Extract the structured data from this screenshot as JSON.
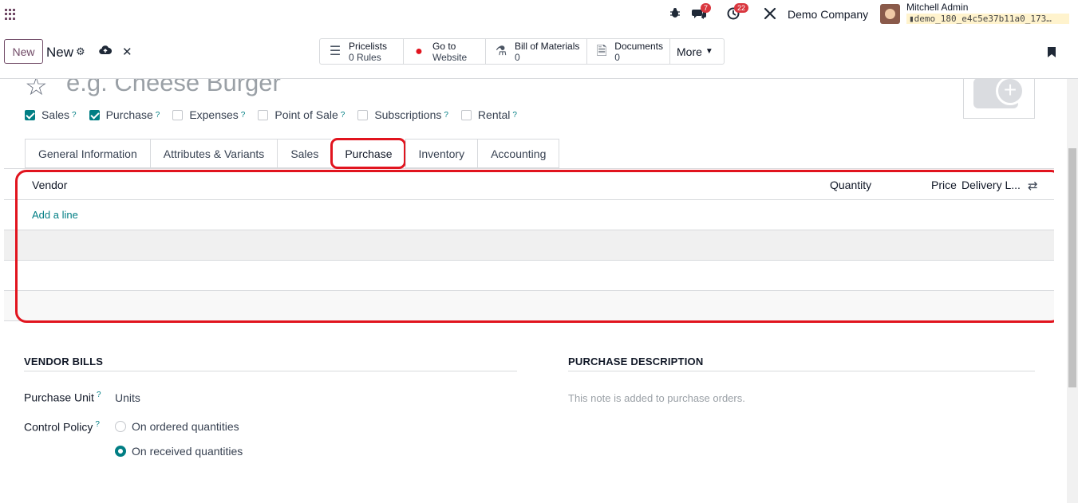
{
  "navbar": {
    "bug_badge": "",
    "messages_badge": "7",
    "activities_badge": "22",
    "company": "Demo Company",
    "user_name": "Mitchell Admin",
    "db_name": "demo_180_e4c5e37b11a0_173…"
  },
  "control": {
    "new_label": "New",
    "breadcrumb": "New",
    "smart_buttons": [
      {
        "title": "Pricelists",
        "sub": "0 Rules",
        "icon": "list-icon"
      },
      {
        "title": "Go to",
        "sub": "Website",
        "icon": "globe-icon"
      },
      {
        "title": "Bill of Materials",
        "sub": "0",
        "icon": "flask-icon"
      },
      {
        "title": "Documents",
        "sub": "0",
        "icon": "document-icon"
      }
    ],
    "more_label": "More"
  },
  "form": {
    "name_placeholder": "e.g. Cheese Burger",
    "checkboxes": [
      {
        "label": "Sales",
        "checked": true
      },
      {
        "label": "Purchase",
        "checked": true
      },
      {
        "label": "Expenses",
        "checked": false
      },
      {
        "label": "Point of Sale",
        "checked": false
      },
      {
        "label": "Subscriptions",
        "checked": false
      },
      {
        "label": "Rental",
        "checked": false
      }
    ],
    "tabs": [
      "General Information",
      "Attributes & Variants",
      "Sales",
      "Purchase",
      "Inventory",
      "Accounting"
    ],
    "active_tab": "Purchase",
    "vendor_list": {
      "columns": [
        "Vendor",
        "Quantity",
        "Price",
        "Delivery L..."
      ],
      "add_line": "Add a line"
    },
    "vendor_bills": {
      "title": "VENDOR BILLS",
      "purchase_unit_label": "Purchase Unit",
      "purchase_unit_value": "Units",
      "control_policy_label": "Control Policy",
      "options": [
        "On ordered quantities",
        "On received quantities"
      ],
      "selected": "On received quantities"
    },
    "purchase_description": {
      "title": "PURCHASE DESCRIPTION",
      "placeholder": "This note is added to purchase orders."
    }
  },
  "colors": {
    "brand": "#714B67",
    "accent": "#017e84",
    "highlight": "#e1141e",
    "badge": "#d9363e"
  }
}
